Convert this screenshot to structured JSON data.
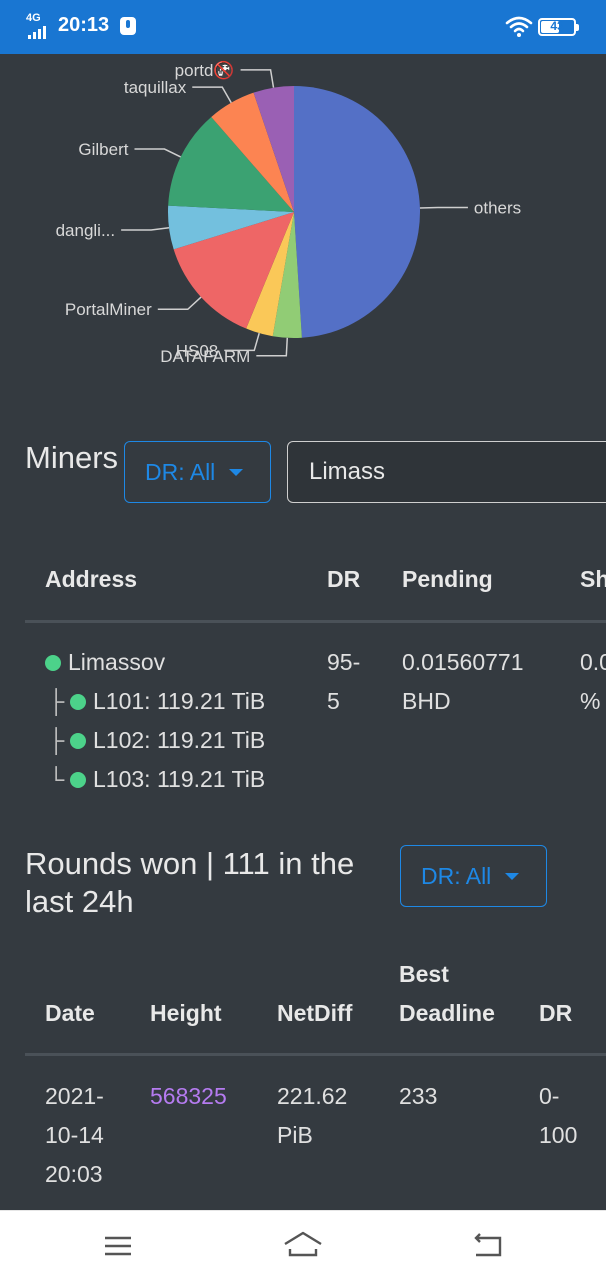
{
  "status_bar": {
    "network": "4G",
    "time": "20:13",
    "battery": "43",
    "icons": [
      "signal-icon",
      "notification-icon",
      "wifi-icon",
      "battery-icon"
    ]
  },
  "chart_data": {
    "type": "pie",
    "slices": [
      {
        "label": "others",
        "value": 49.0,
        "color": "#5470c6"
      },
      {
        "label": "DATAFARM",
        "value": 3.7,
        "color": "#91cc75"
      },
      {
        "label": "HS08",
        "value": 3.5,
        "color": "#fac858"
      },
      {
        "label": "PortalMiner",
        "value": 14.0,
        "color": "#ee6666"
      },
      {
        "label": "dangli...",
        "value": 5.6,
        "color": "#73c0de"
      },
      {
        "label": "Gilbert",
        "value": 12.8,
        "color": "#3ba272"
      },
      {
        "label": "taquillax",
        "value": 6.2,
        "color": "#fc8452"
      },
      {
        "label": "portd🚱",
        "value": 5.2,
        "color": "#9a60b4"
      }
    ]
  },
  "miners": {
    "title": "Miners",
    "dr_filter": "DR: All",
    "search_value": "Limass",
    "columns": [
      "Address",
      "DR",
      "Pending",
      "Sh"
    ],
    "rows": [
      {
        "address": "Limassov",
        "dr_line1": "95-",
        "dr_line2": "5",
        "pending_line1": "0.01560771",
        "pending_line2": "BHD",
        "share_line1": "0.0",
        "share_line2": "%",
        "sub": [
          {
            "tree": "├",
            "label": "L101: 119.21 TiB"
          },
          {
            "tree": "├",
            "label": "L102: 119.21 TiB"
          },
          {
            "tree": "└",
            "label": "L103: 119.21 TiB"
          }
        ]
      }
    ]
  },
  "rounds": {
    "title": "Rounds won | 111 in the last 24h",
    "dr_filter": "DR: All",
    "columns": [
      "Date",
      "Height",
      "NetDiff",
      "Best Deadline",
      "DR"
    ],
    "best_line1": "Best",
    "best_line2": "Deadline",
    "rows": [
      {
        "date_line1": "2021-",
        "date_line2": "10-14",
        "date_line3": "20:03",
        "height": "568325",
        "netdiff_line1": "221.62",
        "netdiff_line2": "PiB",
        "deadline": "233",
        "dr_line1": "0-",
        "dr_line2": "100"
      }
    ]
  },
  "nav_bar": {
    "icons": [
      "menu-icon",
      "home-icon",
      "back-icon"
    ]
  }
}
